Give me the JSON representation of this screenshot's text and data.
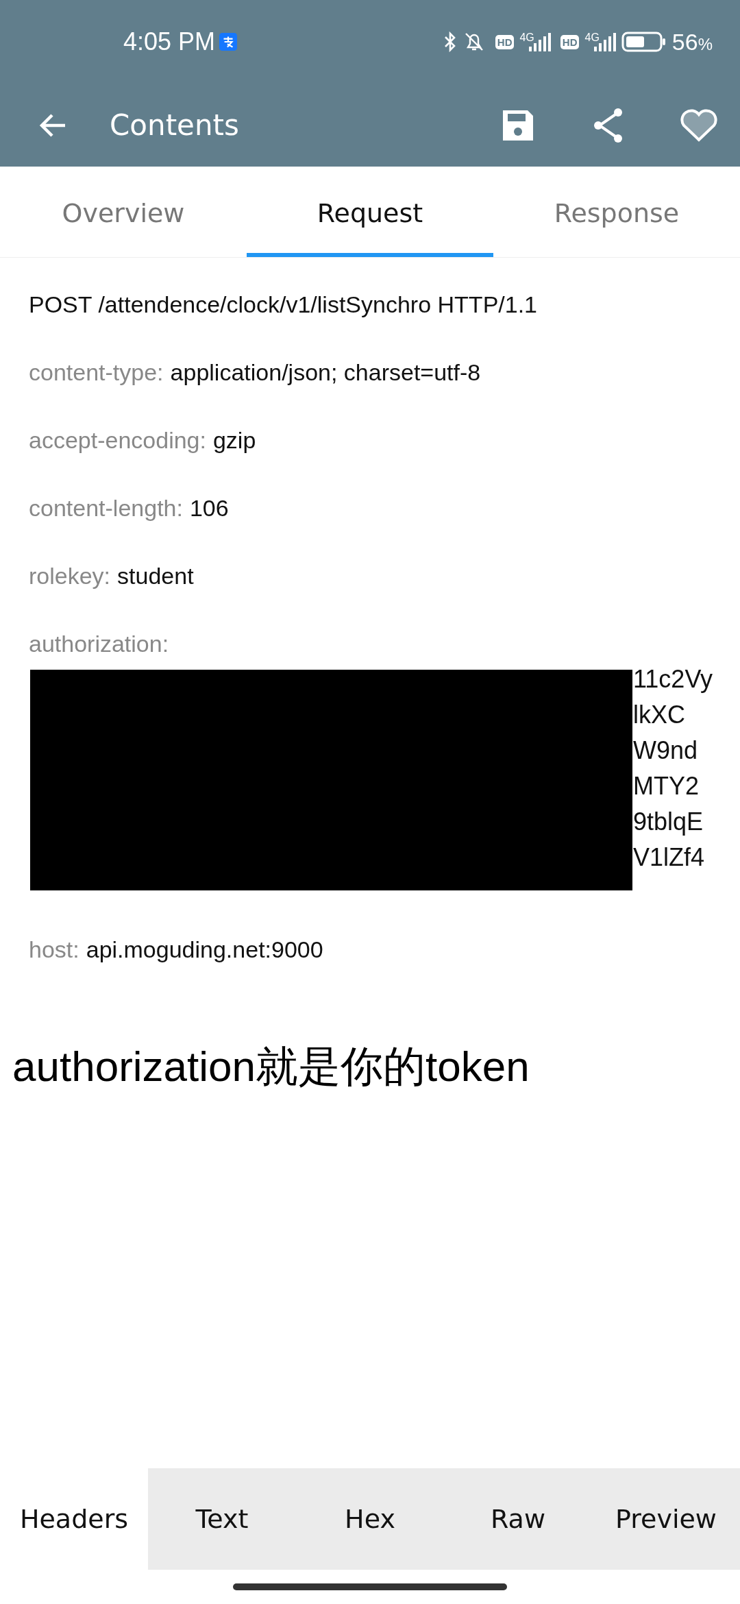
{
  "status_bar": {
    "time": "4:05 PM",
    "sims": [
      {
        "badge": "HD",
        "network": "4G"
      },
      {
        "badge": "HD",
        "network": "4G"
      }
    ],
    "battery": "56",
    "battery_unit": "%"
  },
  "app_bar": {
    "title": "Contents"
  },
  "tabs": [
    {
      "label": "Overview",
      "selected": false
    },
    {
      "label": "Request",
      "selected": true
    },
    {
      "label": "Response",
      "selected": false
    }
  ],
  "request_line": "POST /attendence/clock/v1/listSynchro HTTP/1.1",
  "headers": [
    {
      "key": "content-type:",
      "value": "application/json; charset=utf-8"
    },
    {
      "key": "accept-encoding:",
      "value": "gzip"
    },
    {
      "key": "content-length:",
      "value": "106"
    },
    {
      "key": "rolekey:",
      "value": "student"
    }
  ],
  "authorization": {
    "key": "authorization:",
    "lines": [
      "11c2Vy",
      "lkXC",
      "W9nd",
      "MTY2",
      "9tblqE",
      "V1lZf4"
    ]
  },
  "host": {
    "key": "host:",
    "value": "api.moguding.net:9000"
  },
  "caption": "authorization就是你的token",
  "bottom_tabs": [
    {
      "label": "Headers",
      "selected": true
    },
    {
      "label": "Text",
      "selected": false
    },
    {
      "label": "Hex",
      "selected": false
    },
    {
      "label": "Raw",
      "selected": false
    },
    {
      "label": "Preview",
      "selected": false
    }
  ]
}
